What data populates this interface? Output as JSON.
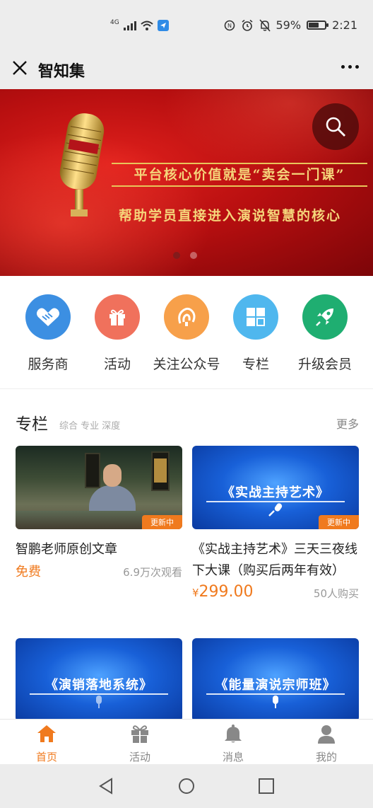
{
  "status_bar": {
    "network": "4G",
    "battery": "59%",
    "time": "2:21"
  },
  "header": {
    "title": "智知集"
  },
  "banner": {
    "line1": "平台核心价值就是“卖会一门课”",
    "line2": "帮助学员直接进入演说智慧的核心"
  },
  "menu": [
    {
      "label": "服务商",
      "icon": "handshake-icon",
      "color": "#3c8fe2"
    },
    {
      "label": "活动",
      "icon": "gift-icon",
      "color": "#f0715c"
    },
    {
      "label": "关注公众号",
      "icon": "wechat-follow-icon",
      "color": "#f7a04a"
    },
    {
      "label": "专栏",
      "icon": "grid-icon",
      "color": "#4fb7ee"
    },
    {
      "label": "升级会员",
      "icon": "rocket-icon",
      "color": "#1fae71"
    }
  ],
  "section": {
    "title": "专栏",
    "subtitle": "综合 专业 深度",
    "more": "更多"
  },
  "cards": [
    {
      "badge": "更新中",
      "title": "智鹏老师原创文章",
      "price": "免费",
      "stat": "6.9万次观看"
    },
    {
      "caption": "《实战主持艺术》",
      "badge": "更新中",
      "title": "《实战主持艺术》三天三夜线下大课（购买后两年有效）",
      "price_symbol": "¥",
      "price": "299.00",
      "stat": "50人购买"
    },
    {
      "caption": "《演销落地系统》"
    },
    {
      "caption": "《能量演说宗师班》"
    }
  ],
  "tabs": [
    {
      "label": "首页",
      "icon": "home-icon"
    },
    {
      "label": "活动",
      "icon": "gift-icon"
    },
    {
      "label": "消息",
      "icon": "bell-icon"
    },
    {
      "label": "我的",
      "icon": "user-icon"
    }
  ],
  "colors": {
    "accent": "#f07a1e",
    "banner_red": "#c8161a",
    "thumb_blue": "#1860d8"
  }
}
